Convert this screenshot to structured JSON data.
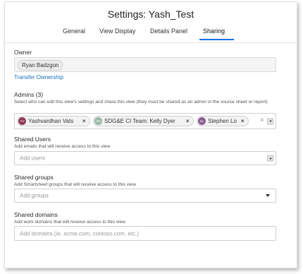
{
  "header": {
    "title": "Settings: Yash_Test"
  },
  "tabs": [
    {
      "label": "General",
      "active": false
    },
    {
      "label": "View Display",
      "active": false
    },
    {
      "label": "Details Panel",
      "active": false
    },
    {
      "label": "Sharing",
      "active": true
    }
  ],
  "owner": {
    "label": "Owner",
    "name": "Ryan Badzgon",
    "transfer_link": "Transfer Ownership"
  },
  "admins": {
    "label": "Admins (3)",
    "description": "Select who can edit this view's settings and share this view (they must be shared as an admin in the source sheet or report)",
    "people": [
      {
        "initials": "YV",
        "name": "Yashvardhan Vats",
        "avatar_color": "#8e3a59"
      },
      {
        "initials": "SD",
        "name": "SDG&E CI Team: Kelly Dyer",
        "avatar_color": "#9bb8a8"
      },
      {
        "initials": "SL",
        "name": "Stephen Lo",
        "avatar_color": "#8b5b92"
      }
    ],
    "remove_glyph": "×",
    "clear_glyph": "×"
  },
  "shared_users": {
    "label": "Shared Users",
    "description": "Add emails that will receive access to this view",
    "placeholder": "Add users"
  },
  "shared_groups": {
    "label": "Shared groups",
    "description": "Add Smartsheet groups that will receive access to this view",
    "placeholder": "Add groups"
  },
  "shared_domains": {
    "label": "Shared domains",
    "description": "Add work domains that will receive access to this view",
    "placeholder": "Add domains (ie. acme.com, contoso.com, etc.)"
  },
  "colors": {
    "accent": "#0073e6",
    "link": "#1a6fbf"
  }
}
